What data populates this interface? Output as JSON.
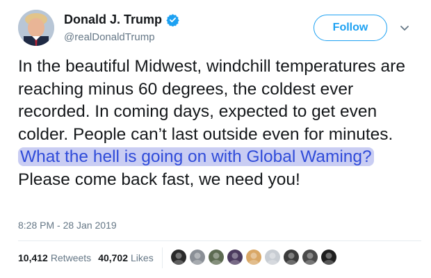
{
  "author": {
    "name": "Donald J. Trump",
    "handle": "@realDonaldTrump",
    "verified_icon": "verified-badge-icon",
    "avatar_icon": "profile-avatar"
  },
  "follow_button": {
    "label": "Follow"
  },
  "menu": {
    "icon": "chevron-down-icon"
  },
  "tweet": {
    "text_before": "In the beautiful Midwest, windchill temperatures are reaching minus 60 degrees, the coldest ever recorded. In coming days, expected to get even colder. People can’t last outside even for minutes.",
    "highlight": "What the hell is going on with Global Waming?",
    "text_after": "Please come back fast, we need you!"
  },
  "timestamp": "8:28 PM - 28 Jan 2019",
  "stats": {
    "retweets_count": "10,412",
    "retweets_label": "Retweets",
    "likes_count": "40,702",
    "likes_label": "Likes"
  },
  "likers": [
    {
      "icon": "liker-avatar",
      "color": "#2a2a2a"
    },
    {
      "icon": "liker-avatar",
      "color": "#8a8f96"
    },
    {
      "icon": "liker-avatar",
      "color": "#5d6b52"
    },
    {
      "icon": "liker-avatar",
      "color": "#4b3a5e"
    },
    {
      "icon": "liker-avatar",
      "color": "#d9a766"
    },
    {
      "icon": "liker-avatar",
      "color": "#c8cdd3"
    },
    {
      "icon": "liker-avatar",
      "color": "#3b3b3b"
    },
    {
      "icon": "liker-avatar",
      "color": "#4a4a4a"
    },
    {
      "icon": "liker-avatar",
      "color": "#1f1f1f"
    }
  ],
  "colors": {
    "brand_blue": "#1da1f2",
    "highlight_bg": "#c9cdf3",
    "highlight_text": "#2f4bd9",
    "muted_text": "#657786"
  }
}
